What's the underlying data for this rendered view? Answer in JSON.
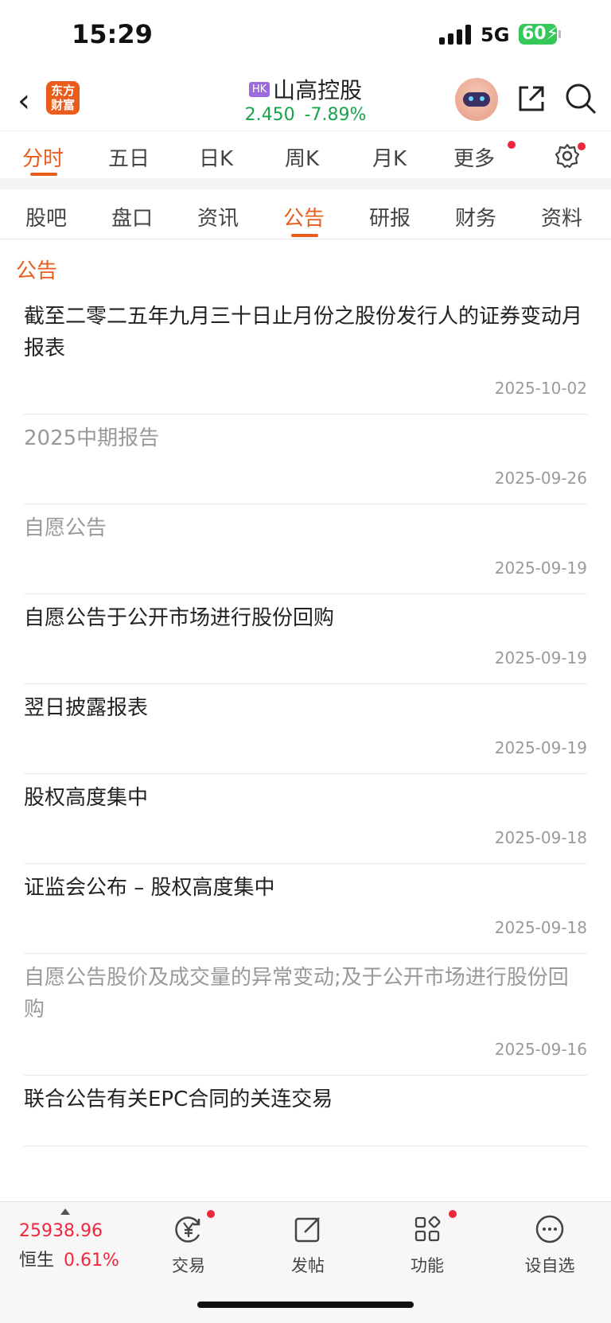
{
  "status_bar": {
    "time": "15:29",
    "network": "5G",
    "battery": "60"
  },
  "header": {
    "logo_line1": "东方",
    "logo_line2": "财富",
    "market_badge": "HK",
    "stock_name": "山高控股",
    "price": "2.450",
    "change_pct": "-7.89%",
    "icons": [
      "back-icon",
      "robot-assistant-icon",
      "share-icon",
      "search-icon"
    ]
  },
  "k_tabs": [
    "分时",
    "五日",
    "日K",
    "周K",
    "月K",
    "更多"
  ],
  "sub_tabs": [
    "股吧",
    "盘口",
    "资讯",
    "公告",
    "研报",
    "财务",
    "资料"
  ],
  "section_title": "公告",
  "announcements": [
    {
      "title": "截至二零二五年九月三十日止月份之股份发行人的证券变动月报表",
      "date": "2025-10-02",
      "read": false
    },
    {
      "title": "2025中期报告",
      "date": "2025-09-26",
      "read": true
    },
    {
      "title": "自愿公告",
      "date": "2025-09-19",
      "read": true
    },
    {
      "title": "自愿公告于公开市场进行股份回购",
      "date": "2025-09-19",
      "read": false
    },
    {
      "title": "翌日披露报表",
      "date": "2025-09-19",
      "read": false
    },
    {
      "title": "股权高度集中",
      "date": "2025-09-18",
      "read": false
    },
    {
      "title": "证监会公布 – 股权高度集中",
      "date": "2025-09-18",
      "read": false
    },
    {
      "title": "自愿公告股价及成交量的异常变动;及于公开市场进行股份回购",
      "date": "2025-09-16",
      "read": true
    },
    {
      "title": "联合公告有关EPC合同的关连交易",
      "date": "",
      "read": false
    }
  ],
  "bottom_bar": {
    "index_value": "25938.96",
    "index_name": "恒生",
    "index_change": "0.61%",
    "items": [
      {
        "label": "交易",
        "icon": "trade-yen-icon",
        "dot": true
      },
      {
        "label": "发帖",
        "icon": "compose-icon",
        "dot": false
      },
      {
        "label": "功能",
        "icon": "apps-grid-icon",
        "dot": true
      },
      {
        "label": "设自选",
        "icon": "more-circle-icon",
        "dot": false
      }
    ]
  },
  "colors": {
    "accent": "#ea5c1c",
    "down_green": "#16a34a",
    "up_red": "#f0263c"
  }
}
